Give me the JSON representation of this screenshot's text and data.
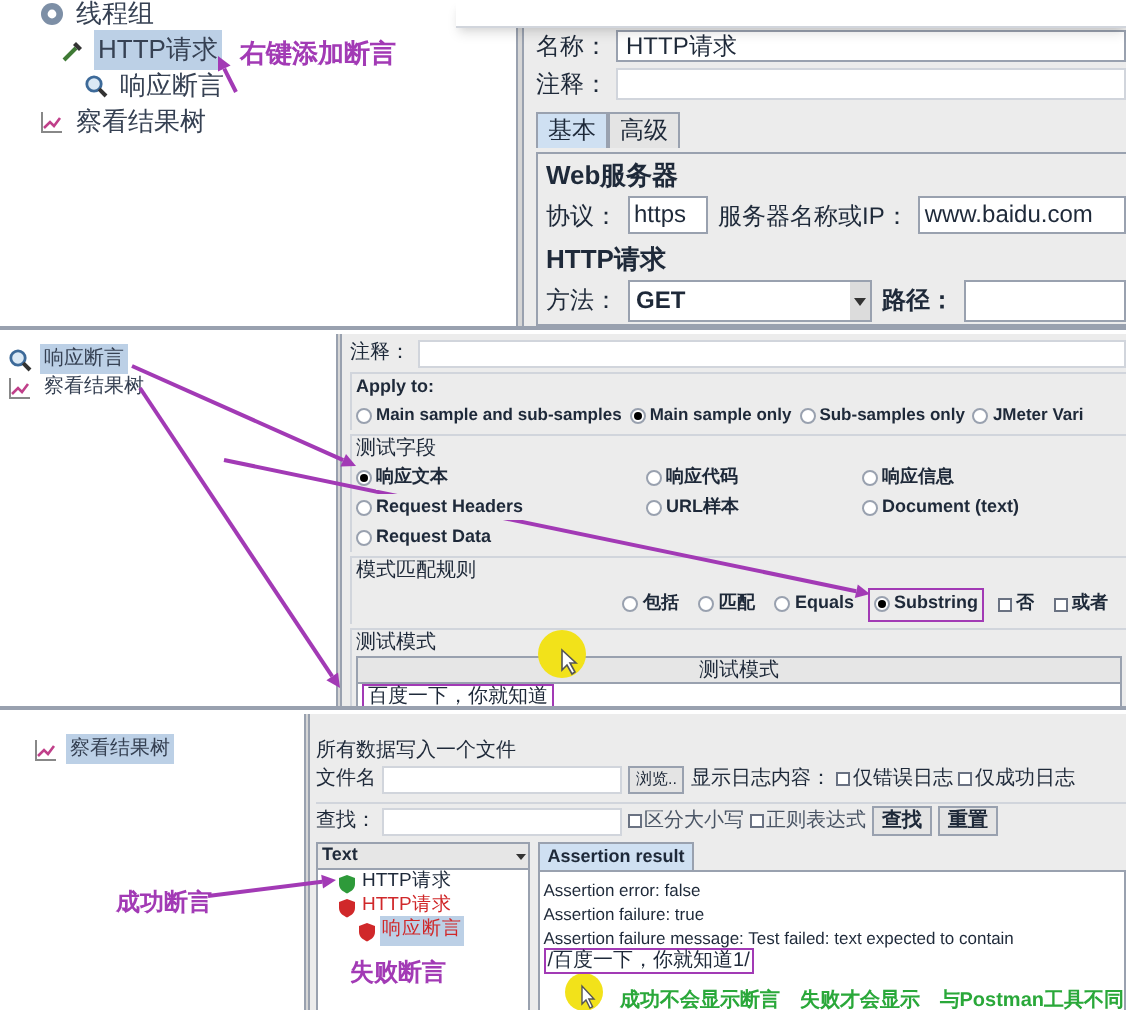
{
  "top_screen": {
    "tree": [
      {
        "label": "线程组",
        "kind": "thread_group",
        "selected": false,
        "children": [
          {
            "label": "HTTP请求",
            "kind": "sampler",
            "selected": true,
            "children": [
              {
                "label": "响应断言",
                "kind": "assertion",
                "selected": false
              }
            ]
          }
        ]
      },
      {
        "label": "察看结果树",
        "kind": "listener",
        "selected": false
      }
    ],
    "annotation": "右键添加断言",
    "form": {
      "name_label": "名称：",
      "name_value": "HTTP请求",
      "comment_label": "注释：",
      "tabs": [
        {
          "label": "基本",
          "selected": true
        },
        {
          "label": "高级",
          "selected": false
        }
      ],
      "web_server_title": "Web服务器",
      "protocol_label": "协议：",
      "protocol_value": "https",
      "server_label": "服务器名称或IP：",
      "server_value": "www.baidu.com",
      "http_title": "HTTP请求",
      "method_label": "方法：",
      "method_value": "GET",
      "path_label": "路径："
    }
  },
  "middle_screen": {
    "tree": [
      {
        "label": "响应断言",
        "kind": "assertion",
        "selected": true
      },
      {
        "label": "察看结果树",
        "kind": "listener",
        "selected": false
      }
    ],
    "comment_label": "注释：",
    "apply_to": {
      "title": "Apply to:",
      "options": [
        {
          "label": "Main sample and sub-samples",
          "selected": false
        },
        {
          "label": "Main sample only",
          "selected": true
        },
        {
          "label": "Sub-samples only",
          "selected": false
        },
        {
          "label": "JMeter Vari",
          "selected": false
        }
      ]
    },
    "test_field": {
      "title": "测试字段",
      "options": [
        {
          "label": "响应文本",
          "selected": true
        },
        {
          "label": "响应代码",
          "selected": false
        },
        {
          "label": "响应信息",
          "selected": false
        },
        {
          "label": "Request Headers",
          "selected": false
        },
        {
          "label": "URL样本",
          "selected": false
        },
        {
          "label": "Document (text)",
          "selected": false
        },
        {
          "label": "Request Data",
          "selected": false
        }
      ]
    },
    "pattern_rules": {
      "title": "模式匹配规则",
      "options": [
        {
          "label": "包括",
          "kind": "radio",
          "selected": false,
          "annotated": false
        },
        {
          "label": "匹配",
          "kind": "radio",
          "selected": false,
          "annotated": false
        },
        {
          "label": "Equals",
          "kind": "radio",
          "selected": false,
          "annotated": false
        },
        {
          "label": "Substring",
          "kind": "radio",
          "selected": true,
          "annotated": true
        },
        {
          "label": "否",
          "kind": "checkbox",
          "checked": false,
          "annotated": false
        },
        {
          "label": "或者",
          "kind": "checkbox",
          "checked": false,
          "annotated": false
        }
      ]
    },
    "test_patterns": {
      "title": "测试模式",
      "column": "测试模式",
      "rows": [
        {
          "text": "百度一下，你就知道",
          "annotated": true
        }
      ]
    }
  },
  "bottom_screen": {
    "tree": [
      {
        "label": "察看结果树",
        "kind": "listener",
        "selected": true
      }
    ],
    "write_all_title": "所有数据写入一个文件",
    "file_label": "文件名",
    "browse_button": "浏览..",
    "log_label": "显示日志内容：",
    "log_options": [
      {
        "label": "仅错误日志",
        "checked": false
      },
      {
        "label": "仅成功日志",
        "checked": false
      }
    ],
    "search_label": "查找：",
    "search_options": [
      {
        "label": "区分大小写",
        "checked": false
      },
      {
        "label": "正则表达式",
        "checked": false
      }
    ],
    "buttons": [
      "查找",
      "重置"
    ],
    "result_tree": {
      "header": "Text",
      "items": [
        {
          "label": "HTTP请求",
          "kind": "success",
          "selected": false
        },
        {
          "label": "HTTP请求",
          "kind": "failure",
          "selected": false,
          "children": [
            {
              "label": "响应断言",
              "kind": "failure",
              "selected": true
            }
          ]
        }
      ]
    },
    "result_tabs": [
      {
        "label": "Assertion result",
        "selected": true
      }
    ],
    "result_lines": [
      {
        "text": "Assertion error: false"
      },
      {
        "text": "Assertion failure: true"
      },
      {
        "text": "Assertion failure message: Test failed: text expected to contain ",
        "annotated_part": "/百度一下，你就知道1/"
      }
    ],
    "success_annotation": "成功断言",
    "failure_annotation": "失败断言",
    "notes": [
      "成功不会显示断言",
      "失败才会显示",
      "与Postman工具不同"
    ]
  }
}
